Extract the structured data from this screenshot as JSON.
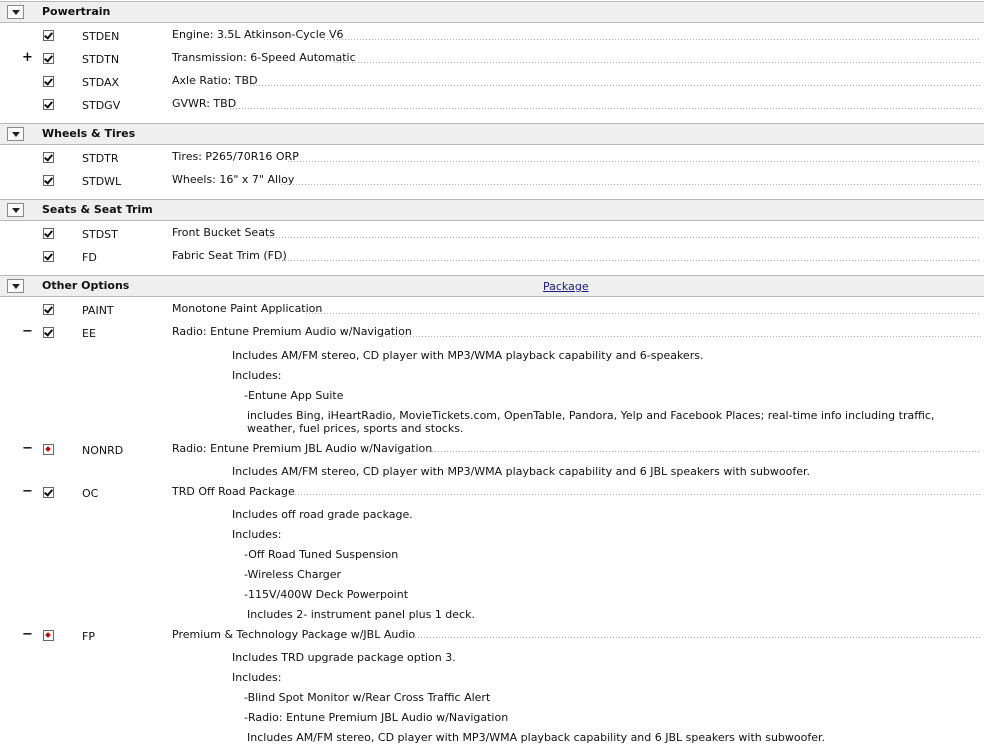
{
  "sections": [
    {
      "title": "Powertrain",
      "link": ""
    },
    {
      "title": "Wheels & Tires",
      "link": ""
    },
    {
      "title": "Seats & Seat Trim",
      "link": ""
    },
    {
      "title": "Other Options",
      "link": "Package"
    }
  ],
  "powertrain": [
    {
      "code": "STDEN",
      "desc": "Engine: 3.5L Atkinson-Cycle V6",
      "toggle": ""
    },
    {
      "code": "STDTN",
      "desc": "Transmission: 6-Speed Automatic",
      "toggle": "+"
    },
    {
      "code": "STDAX",
      "desc": "Axle Ratio: TBD",
      "toggle": ""
    },
    {
      "code": "STDGV",
      "desc": "GVWR: TBD",
      "toggle": ""
    }
  ],
  "wheels": [
    {
      "code": "STDTR",
      "desc": "Tires: P265/70R16 ORP"
    },
    {
      "code": "STDWL",
      "desc": "Wheels: 16\" x 7\" Alloy"
    }
  ],
  "seats": [
    {
      "code": "STDST",
      "desc": "Front Bucket Seats"
    },
    {
      "code": "FD",
      "desc": "Fabric Seat Trim (FD)"
    }
  ],
  "other": [
    {
      "code": "PAINT",
      "desc": "Monotone Paint Application",
      "toggle": ""
    },
    {
      "code": "EE",
      "desc": "Radio: Entune Premium Audio w/Navigation",
      "toggle": "−",
      "notes": [
        "Includes AM/FM stereo, CD player with MP3/WMA playback capability and 6-speakers.",
        "Includes:",
        "-Entune App Suite",
        "includes Bing, iHeartRadio, MovieTickets.com, OpenTable, Pandora, Yelp and Facebook Places; real-time info including traffic, weather, fuel prices, sports and stocks."
      ]
    },
    {
      "code": "NONRD",
      "desc": "Radio: Entune Premium JBL Audio w/Navigation",
      "toggle": "−",
      "notes": [
        "Includes AM/FM stereo, CD player with MP3/WMA playback capability and 6 JBL speakers with subwoofer."
      ]
    },
    {
      "code": "OC",
      "desc": "TRD Off Road Package",
      "toggle": "−",
      "notes": [
        "Includes off road grade package.",
        "Includes:",
        "-Off Road Tuned Suspension",
        "-Wireless Charger",
        "-115V/400W Deck Powerpoint",
        "Includes 2- instrument panel plus 1 deck."
      ]
    },
    {
      "code": "FP",
      "desc": "Premium & Technology Package w/JBL Audio",
      "toggle": "−",
      "notes": [
        "Includes TRD upgrade package option 3.",
        "Includes:",
        "-Blind Spot Monitor w/Rear Cross Traffic Alert",
        "-Radio: Entune Premium JBL Audio w/Navigation",
        "Includes AM/FM stereo, CD player with MP3/WMA playback capability and 6 JBL speakers with subwoofer."
      ]
    }
  ]
}
